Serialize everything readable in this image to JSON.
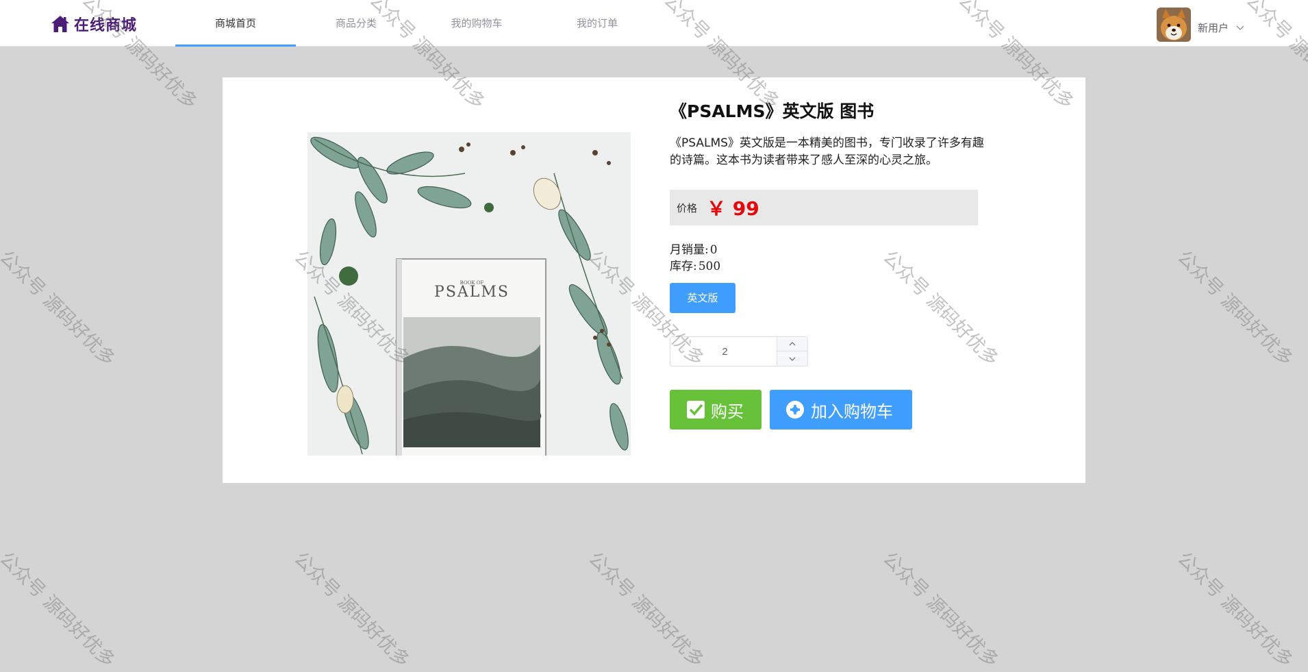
{
  "header": {
    "logo_text": "在线商城",
    "logo_icon": "home-icon",
    "nav": [
      {
        "label": "商城首页",
        "active": true
      },
      {
        "label": "商品分类",
        "active": false
      },
      {
        "label": "我的购物车",
        "active": false
      },
      {
        "label": "我的订单",
        "active": false
      }
    ],
    "username": "新用户",
    "avatar": "shiba-dog-avatar",
    "dropdown_icon": "chevron-down-icon"
  },
  "product": {
    "title": "《PSALMS》英文版 图书",
    "description": "《PSALMS》英文版是一本精美的图书，专门收录了许多有趣的诗篇。这本书为读者带来了感人至深的心灵之旅。",
    "image_text_small": "BOOK OF",
    "image_text_title": "PSALMS",
    "price_label": "价格",
    "price": "￥ 99",
    "monthly_sales_label": "月销量:",
    "monthly_sales": "0",
    "stock_label": "库存:",
    "stock": "500",
    "variant": "英文版",
    "quantity": "2",
    "buy_label": "购买",
    "cart_label": "加入购物车"
  },
  "colors": {
    "accent": "#409eff",
    "buy_green": "#67c23a",
    "price_red": "#e4080a",
    "logo_purple": "#4b1d78"
  },
  "watermark": "公众号 源码好优多"
}
